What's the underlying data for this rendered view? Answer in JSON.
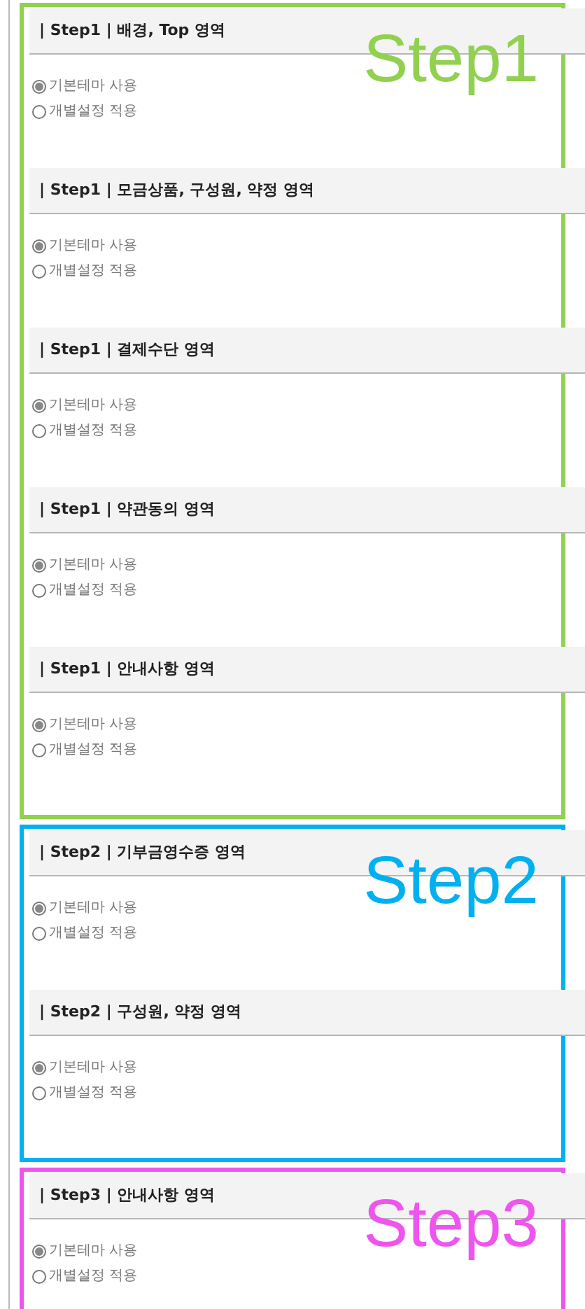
{
  "groups": [
    {
      "label": "Step1",
      "color": "#92d050",
      "sections": [
        {
          "title": "| Step1 | 배경, Top 영역",
          "options": [
            {
              "label": "기본테마 사용",
              "selected": true
            },
            {
              "label": "개별설정 적용",
              "selected": false
            }
          ]
        },
        {
          "title": "| Step1 | 모금상품, 구성원, 약정 영역",
          "options": [
            {
              "label": "기본테마 사용",
              "selected": true
            },
            {
              "label": "개별설정 적용",
              "selected": false
            }
          ]
        },
        {
          "title": "| Step1 | 결제수단 영역",
          "options": [
            {
              "label": "기본테마 사용",
              "selected": true
            },
            {
              "label": "개별설정 적용",
              "selected": false
            }
          ]
        },
        {
          "title": "| Step1 | 약관동의 영역",
          "options": [
            {
              "label": "기본테마 사용",
              "selected": true
            },
            {
              "label": "개별설정 적용",
              "selected": false
            }
          ]
        },
        {
          "title": "| Step1 | 안내사항 영역",
          "options": [
            {
              "label": "기본테마 사용",
              "selected": true
            },
            {
              "label": "개별설정 적용",
              "selected": false
            }
          ]
        }
      ]
    },
    {
      "label": "Step2",
      "color": "#00b0f0",
      "sections": [
        {
          "title": "| Step2 | 기부금영수증 영역",
          "options": [
            {
              "label": "기본테마 사용",
              "selected": true
            },
            {
              "label": "개별설정 적용",
              "selected": false
            }
          ]
        },
        {
          "title": "| Step2 | 구성원, 약정 영역",
          "options": [
            {
              "label": "기본테마 사용",
              "selected": true
            },
            {
              "label": "개별설정 적용",
              "selected": false
            }
          ]
        }
      ]
    },
    {
      "label": "Step3",
      "color": "#ee55ee",
      "sections": [
        {
          "title": "| Step3 | 안내사항 영역",
          "options": [
            {
              "label": "기본테마 사용",
              "selected": true
            },
            {
              "label": "개별설정 적용",
              "selected": false
            }
          ]
        }
      ]
    }
  ]
}
